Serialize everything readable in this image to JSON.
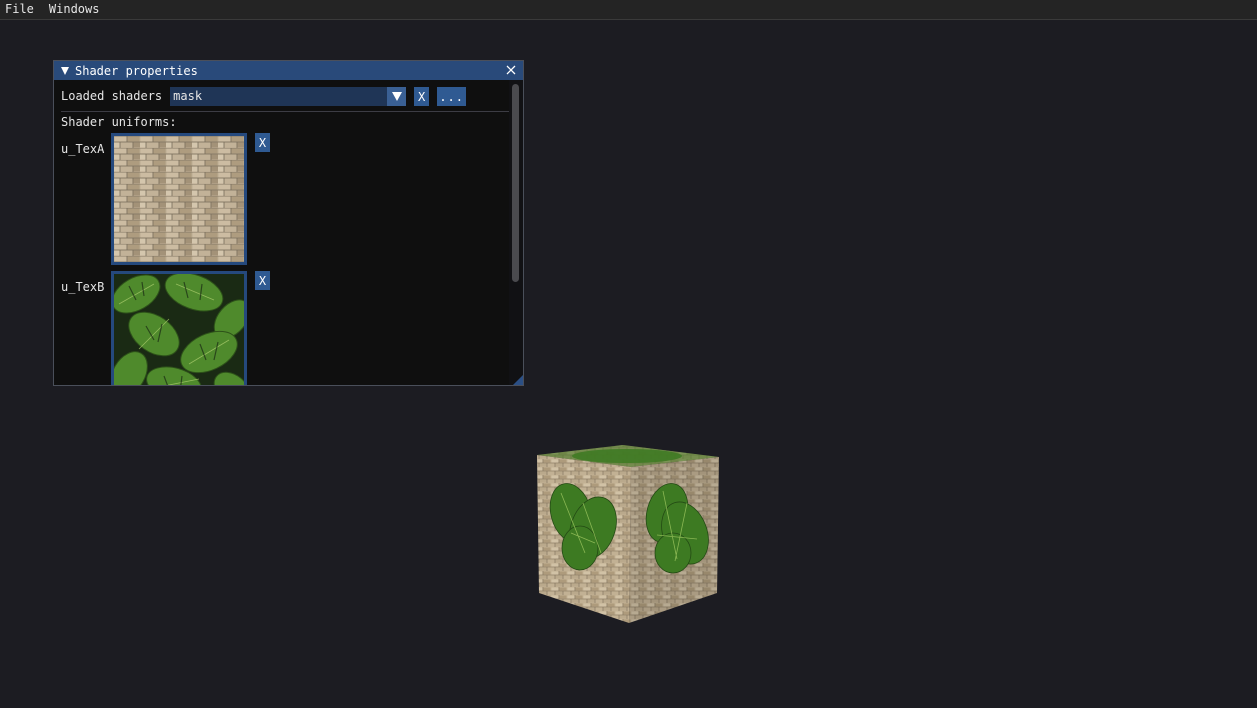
{
  "menubar": {
    "items": [
      {
        "label": "File"
      },
      {
        "label": "Windows"
      }
    ]
  },
  "shader_window": {
    "title": "Shader properties",
    "loaded_shaders_label": "Loaded shaders",
    "selected_shader": "mask",
    "clear_button_label": "X",
    "browse_button_label": "...",
    "uniforms_heading": "Shader uniforms:",
    "uniforms": [
      {
        "name": "u_TexA",
        "texture": "stone-brick-texture",
        "clear_label": "X"
      },
      {
        "name": "u_TexB",
        "texture": "monstera-leaves-texture",
        "clear_label": "X"
      }
    ]
  },
  "colors": {
    "background": "#1c1c22",
    "title_bar": "#294a7a",
    "button": "#2f5a92",
    "combo": "#1f3556"
  },
  "icons": {
    "collapse": "triangle-down-icon",
    "close": "close-icon",
    "combo": "chevron-down-icon"
  }
}
